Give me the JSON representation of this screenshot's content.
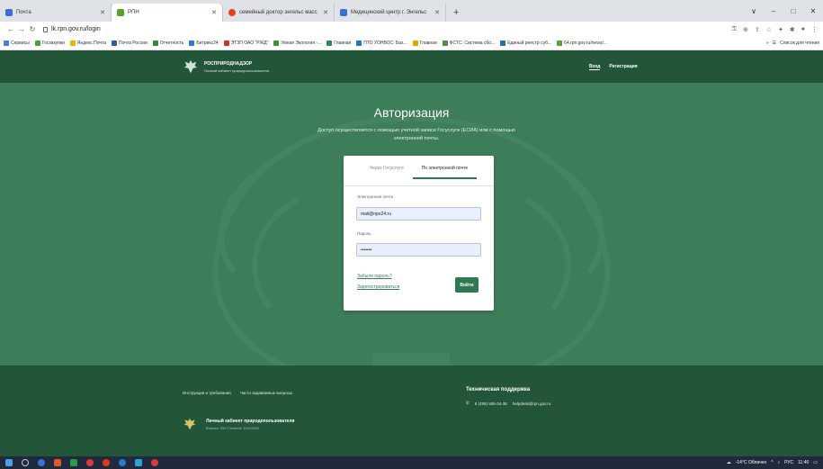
{
  "browser": {
    "tabs": [
      {
        "label": "Почта",
        "color": "#3b6fd6",
        "active": false
      },
      {
        "label": "РПН",
        "color": "#5aa02c",
        "active": true
      },
      {
        "label": "семейный доктор энгельс масс",
        "color": "#e2421c",
        "active": false
      },
      {
        "label": "Медицинский центр г. Энгельс",
        "color": "#3b6fd6",
        "active": false
      }
    ],
    "new_tab": "+",
    "window_controls": [
      "∨",
      "–",
      "□",
      "✕"
    ],
    "url": "lk.rpn.gov.ru/login",
    "bookmarks": [
      {
        "label": "Сервисы",
        "color": "#4a7ddc"
      },
      {
        "label": "Госзакупки",
        "color": "#4aa23b"
      },
      {
        "label": "Яндекс.Почта",
        "color": "#f0b400"
      },
      {
        "label": "Почта России",
        "color": "#2b5cae"
      },
      {
        "label": "Отчетность",
        "color": "#2d8a3e"
      },
      {
        "label": "Битрикс24",
        "color": "#2a7ad6"
      },
      {
        "label": "ЭТЗП ОАО \"РЖД\"",
        "color": "#d62e2e"
      },
      {
        "label": "Умная Экология -...",
        "color": "#3f8f3a"
      },
      {
        "label": "Главная",
        "color": "#2a8c4a"
      },
      {
        "label": "ПТО УОНВОС: Бах...",
        "color": "#1e78c8"
      },
      {
        "label": "Главная",
        "color": "#f0a000"
      },
      {
        "label": "ФСТС: Система сбо...",
        "color": "#4d8f3a"
      },
      {
        "label": "Единый реестр суб...",
        "color": "#2b6bb8"
      },
      {
        "label": "64.rpn.gov.ru/news/...",
        "color": "#5aa02c"
      }
    ],
    "bookmarks_more": "»",
    "reading_list": "Список для чтения"
  },
  "site": {
    "logo_title": "РОСПРИРОДНАДЗОР",
    "logo_subtitle": "Личный кабинет природопользователя",
    "nav": {
      "login": "Вход",
      "register": "Регистрация"
    },
    "auth_title": "Авторизация",
    "auth_desc": "Доступ осуществляется с помощью учетной записи Госуслуги (ЕСИА) или с помощью электронной почты.",
    "tabs": {
      "gosuslugi": "Через Госуслуги",
      "email": "По электронной почте"
    },
    "email_label": "Электронная почта",
    "email_value": "mail@npo24.ru",
    "password_label": "Пароль",
    "password_value": "•••••••",
    "forgot_link": "Забыли пароль?",
    "register_link": "Зарегистрироваться",
    "login_button": "Войти",
    "footer": {
      "links": [
        "Инструкции и требования",
        "Часто задаваемые вопросы"
      ],
      "support_title": "Техническая поддержка",
      "support_phone": "8 (495) 565-34-38",
      "support_email": "helpdesk@rpn.gov.ru",
      "brand_title": "Личный кабинет природопользователя",
      "brand_version": "Версия: 09e77ec6a3e 10012054"
    }
  },
  "taskbar": {
    "weather": "-14°C Облачно",
    "lang": "РУС",
    "time": "11:40"
  }
}
